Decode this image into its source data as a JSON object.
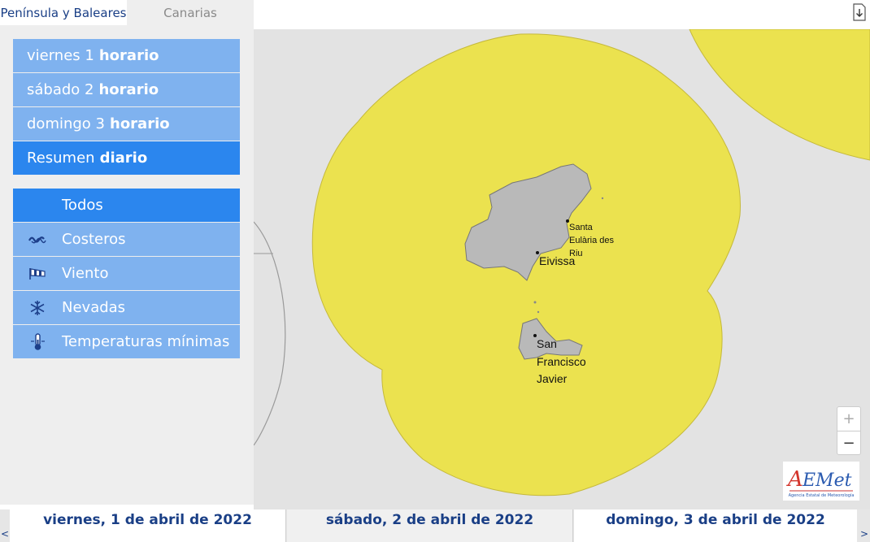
{
  "tabs": [
    {
      "label": "Península y Baleares",
      "active": true
    },
    {
      "label": "Canarias",
      "active": false
    }
  ],
  "days_menu": [
    {
      "prefix": "viernes 1",
      "suffix": "horario"
    },
    {
      "prefix": "sábado 2",
      "suffix": "horario"
    },
    {
      "prefix": "domingo 3",
      "suffix": "horario"
    },
    {
      "prefix": "Resumen",
      "suffix": "diario",
      "selected": true
    }
  ],
  "types_menu": [
    {
      "label": "Todos",
      "icon": "",
      "selected": true
    },
    {
      "label": "Costeros",
      "icon": "waves-icon"
    },
    {
      "label": "Viento",
      "icon": "windsock-icon"
    },
    {
      "label": "Nevadas",
      "icon": "snowflake-icon"
    },
    {
      "label": "Temperaturas mínimas",
      "icon": "thermometer-icon"
    }
  ],
  "map": {
    "places": [
      "Santa",
      "Eulària des",
      "Riu",
      "Eivissa",
      "San",
      "Francisco",
      "Javier"
    ],
    "zoom_in": "+",
    "zoom_out": "−",
    "warning_color": "#ebe24f",
    "land_color": "#b9b9b9",
    "sea_color": "#e3e3e3"
  },
  "logo": {
    "text": "AEMet",
    "subtext": "Agencia Estatal de Meteorología"
  },
  "dates": [
    "viernes, 1 de abril de 2022",
    "sábado, 2 de abril de 2022",
    "domingo, 3 de abril de 2022"
  ],
  "nav": {
    "prev": "<",
    "next": ">"
  },
  "accent_colors": {
    "menu": "#7fb2ef",
    "menu_selected": "#2b86ee",
    "text_dark": "#1a3f86"
  }
}
